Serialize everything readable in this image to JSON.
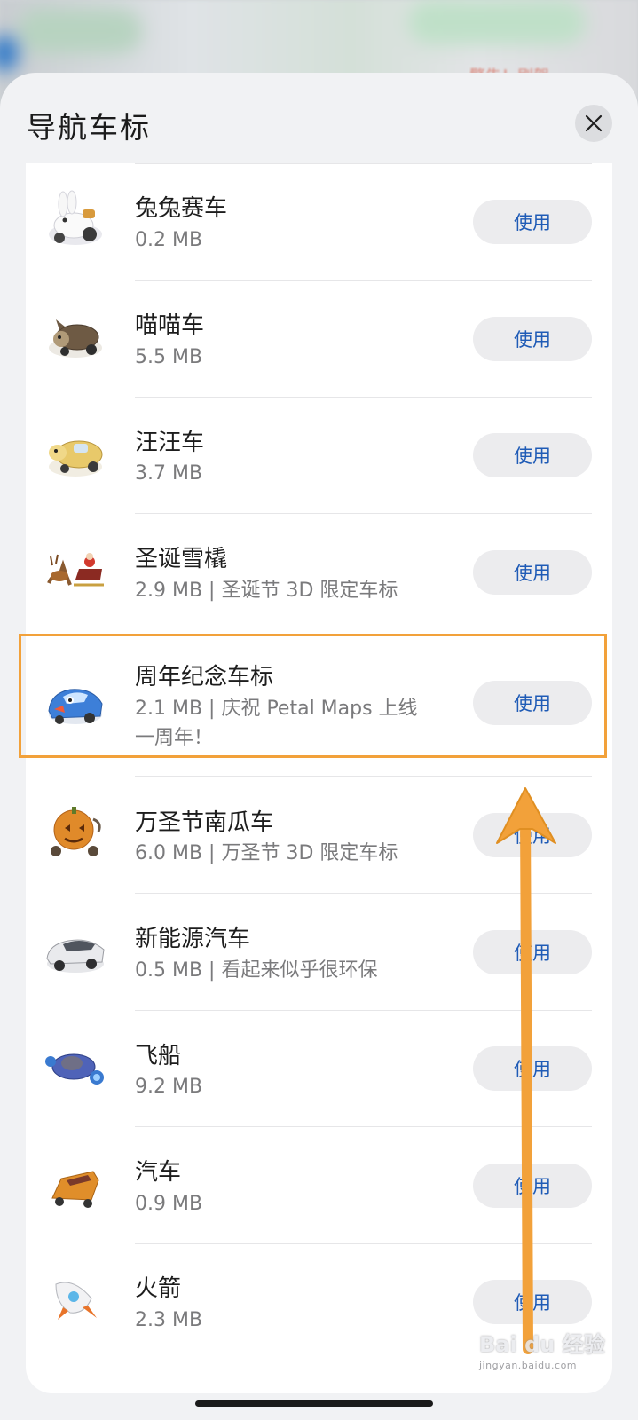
{
  "map_hint": "警告！刷驾",
  "sheet": {
    "title": "导航车标"
  },
  "items": [
    {
      "name": "兔兔赛车",
      "meta": "0.2 MB",
      "button": "使用",
      "icon": "rabbit-car-icon"
    },
    {
      "name": "喵喵车",
      "meta": "5.5 MB",
      "button": "使用",
      "icon": "cat-car-icon"
    },
    {
      "name": "汪汪车",
      "meta": "3.7 MB",
      "button": "使用",
      "icon": "dog-car-icon"
    },
    {
      "name": "圣诞雪橇",
      "meta": "2.9 MB | 圣诞节 3D 限定车标",
      "button": "使用",
      "icon": "christmas-sleigh-icon"
    },
    {
      "name": "周年纪念车标",
      "meta": "2.1 MB | 庆祝 Petal Maps 上线一周年！",
      "button": "使用",
      "icon": "anniversary-car-icon"
    },
    {
      "name": "万圣节南瓜车",
      "meta": "6.0 MB | 万圣节 3D 限定车标",
      "button": "使用",
      "icon": "pumpkin-car-icon"
    },
    {
      "name": "新能源汽车",
      "meta": "0.5 MB | 看起来似乎很环保",
      "button": "使用",
      "icon": "ev-car-icon"
    },
    {
      "name": "飞船",
      "meta": "9.2 MB",
      "button": "使用",
      "icon": "spaceship-icon"
    },
    {
      "name": "汽车",
      "meta": "0.9 MB",
      "button": "使用",
      "icon": "car-icon"
    },
    {
      "name": "火箭",
      "meta": "2.3 MB",
      "button": "使用",
      "icon": "rocket-icon"
    }
  ],
  "watermark": {
    "main": "Bai du 经验",
    "sub": "jingyan.baidu.com"
  },
  "colors": {
    "accent": "#1f5bb6",
    "highlight": "#f2a13a"
  }
}
